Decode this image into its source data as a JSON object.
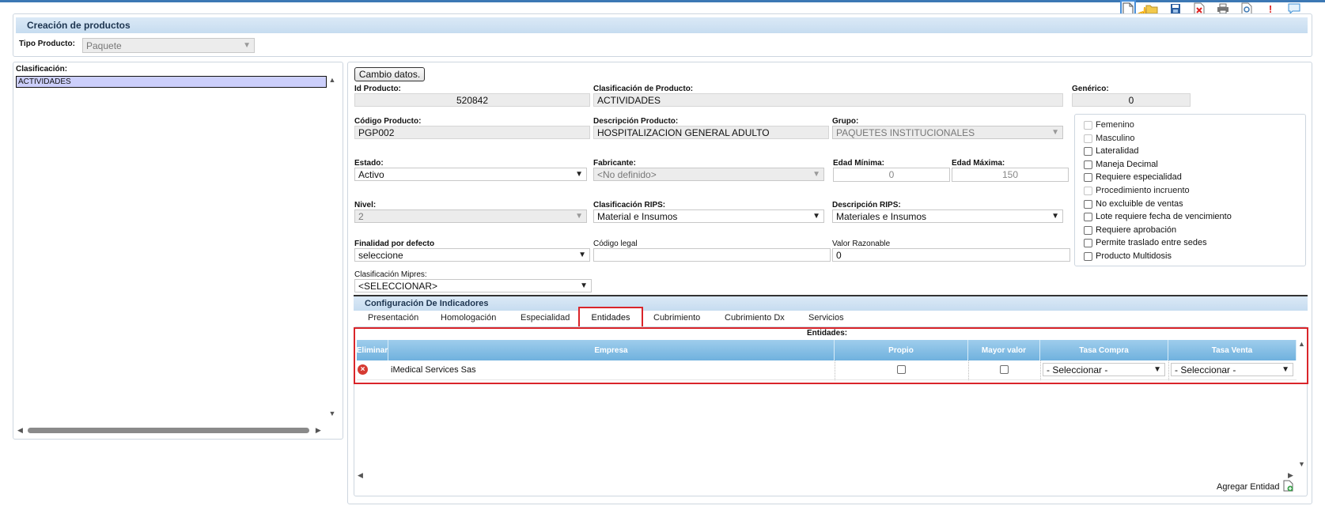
{
  "title": "Creación de productos",
  "tipo_producto": {
    "label": "Tipo Producto:",
    "value": "Paquete"
  },
  "clasificacion": {
    "label": "Clasificación:",
    "items": [
      "ACTIVIDADES"
    ]
  },
  "cambio_datos": "Cambio datos.",
  "fields": {
    "id_producto": {
      "label": "Id Producto:",
      "value": "520842"
    },
    "clasificacion_producto": {
      "label": "Clasificación de Producto:",
      "value": "ACTIVIDADES"
    },
    "generico": {
      "label": "Genérico:",
      "value": "0"
    },
    "codigo_producto": {
      "label": "Código Producto:",
      "value": "PGP002"
    },
    "descripcion_producto": {
      "label": "Descripción Producto:",
      "value": "HOSPITALIZACION GENERAL ADULTO"
    },
    "grupo": {
      "label": "Grupo:",
      "value": "PAQUETES INSTITUCIONALES"
    },
    "estado": {
      "label": "Estado:",
      "value": "Activo"
    },
    "fabricante": {
      "label": "Fabricante:",
      "value": "<No definido>"
    },
    "edad_minima": {
      "label": "Edad Mínima:",
      "value": "0"
    },
    "edad_maxima": {
      "label": "Edad Máxima:",
      "value": "150"
    },
    "nivel": {
      "label": "Nivel:",
      "value": "2"
    },
    "clasificacion_rips": {
      "label": "Clasificación RIPS:",
      "value": "Material e Insumos"
    },
    "descripcion_rips": {
      "label": "Descripción RIPS:",
      "value": "Materiales e Insumos"
    },
    "finalidad": {
      "label": "Finalidad por defecto",
      "value": "seleccione"
    },
    "codigo_legal": {
      "label": "Código legal",
      "value": ""
    },
    "valor_razonable": {
      "label": "Valor Razonable",
      "value": "0"
    },
    "clasificacion_mipres": {
      "label": "Clasificación Mipres:",
      "value": "<SELECCIONAR>"
    }
  },
  "checkboxes": [
    {
      "label": "Femenino",
      "checked": false,
      "disabled": true
    },
    {
      "label": "Masculino",
      "checked": false,
      "disabled": true
    },
    {
      "label": "Lateralidad",
      "checked": false,
      "disabled": false
    },
    {
      "label": "Maneja Decimal",
      "checked": false,
      "disabled": false
    },
    {
      "label": "Requiere especialidad",
      "checked": false,
      "disabled": false
    },
    {
      "label": "Procedimiento incruento",
      "checked": false,
      "disabled": true
    },
    {
      "label": "No excluible de ventas",
      "checked": false,
      "disabled": false
    },
    {
      "label": "Lote requiere fecha de vencimiento",
      "checked": false,
      "disabled": false
    },
    {
      "label": "Requiere aprobación",
      "checked": false,
      "disabled": false
    },
    {
      "label": "Permite traslado entre sedes",
      "checked": false,
      "disabled": false
    },
    {
      "label": "Producto Multidosis",
      "checked": false,
      "disabled": false
    }
  ],
  "indicadores": {
    "title": "Configuración De Indicadores",
    "tabs": [
      "Presentación",
      "Homologación",
      "Especialidad",
      "Entidades",
      "Cubrimiento",
      "Cubrimiento Dx",
      "Servicios"
    ],
    "active_tab": "Entidades"
  },
  "entidades": {
    "title": "Entidades:",
    "columns": [
      "Eliminar",
      "Empresa",
      "Propio",
      "Mayor valor",
      "Tasa Compra",
      "Tasa Venta"
    ],
    "rows": [
      {
        "empresa": "iMedical Services Sas",
        "propio": false,
        "mayor_valor": false,
        "tasa_compra": "- Seleccionar -",
        "tasa_venta": "- Seleccionar -"
      }
    ],
    "add_label": "Agregar Entidad"
  },
  "colors": {
    "accent": "#3c78b4",
    "header_bg": "#c6dcf0",
    "grid_header": "#6fb1de",
    "highlight": "#d9252a",
    "selected_item": "#cccffb"
  },
  "toolbar_icons": [
    "new-document-icon",
    "folder-icon",
    "save-icon",
    "delete-icon",
    "print-icon",
    "preview-icon",
    "help-icon",
    "chat-icon"
  ]
}
